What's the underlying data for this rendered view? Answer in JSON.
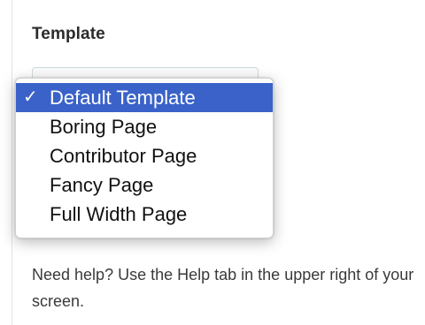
{
  "panel": {
    "title": "Template"
  },
  "dropdown": {
    "items": [
      {
        "label": "Default Template",
        "selected": true,
        "check": "✓"
      },
      {
        "label": "Boring Page",
        "selected": false
      },
      {
        "label": "Contributor Page",
        "selected": false
      },
      {
        "label": "Fancy Page",
        "selected": false
      },
      {
        "label": "Full Width Page",
        "selected": false
      }
    ],
    "accent_color": "#3a62c8"
  },
  "help": {
    "text": "Need help? Use the Help tab in the upper right of your screen."
  }
}
